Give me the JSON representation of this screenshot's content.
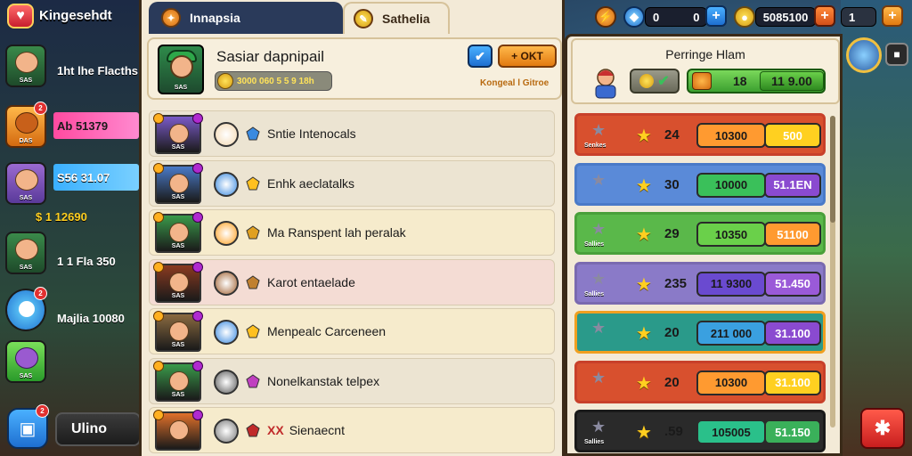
{
  "app": {
    "title": "Kingesehdt",
    "logo_icon": "shield-heart-icon"
  },
  "topbar": {
    "resources": [
      {
        "icon": "lightning-coin-icon",
        "value": ""
      },
      {
        "icon": "blue-gem-icon",
        "value": "0"
      },
      {
        "icon": "gem-value-icon",
        "value": "0"
      },
      {
        "icon": "gold-coin-icon",
        "value": "5085100"
      },
      {
        "icon": "extra-icon",
        "value": "1"
      }
    ],
    "plus_label": "+"
  },
  "tabs": [
    {
      "label": "Innapsia",
      "icon": "orange-token-icon",
      "active": true
    },
    {
      "label": "Sathelia",
      "icon": "gold-token-icon",
      "active": false
    }
  ],
  "sidebar": {
    "items": [
      {
        "tag": "SAS",
        "stat": "1ht lhe Flacths",
        "stat_color": "#ffffff",
        "badge": ""
      },
      {
        "tag": "DAS",
        "stat": "Ab 51379",
        "stat_color": "#ff62b0",
        "badge": "2"
      },
      {
        "tag": "SAS",
        "stat": "S56 31.07",
        "stat_color": "#5ac8ff",
        "badge": ""
      },
      {
        "tag": "",
        "stat": "$ 1 12690",
        "stat_color": "#ffffff",
        "badge": ""
      },
      {
        "tag": "SAS",
        "stat": "1 1 Fla 350",
        "stat_color": "#ffffff",
        "badge": ""
      },
      {
        "tag": "",
        "stat": "Majlia 10080",
        "stat_color": "#ffffff",
        "badge": "2"
      },
      {
        "tag": "SAS",
        "stat": "",
        "stat_color": "#ffffff",
        "badge": ""
      }
    ],
    "bottom_badge": "2",
    "bottom_label": "Ulino"
  },
  "profile": {
    "name": "Sasiar dapnipail",
    "avatar_label": "SAS",
    "currency": "3000 060 5 5 9 18h",
    "check_label": "✔",
    "button_label": "+ OKT",
    "sub_text": "Kongeal l Gitroe"
  },
  "quests": [
    {
      "title": "Sntie Intenocals",
      "bg": "#ece4d2",
      "thumb": "#7a5ac8",
      "circ": "#f4d8b0",
      "gem": "#3a8ae0",
      "cap": "SAS"
    },
    {
      "title": "Enhk aeclatalks",
      "bg": "#ece4d2",
      "thumb": "#4a7ac8",
      "circ": "#3a8ae0",
      "gem": "#ffc020",
      "cap": "SAS"
    },
    {
      "title": "Ma Ranspent lah peralak",
      "bg": "#f6ebcc",
      "thumb": "#3a9a4a",
      "circ": "#ffa020",
      "gem": "#e0a020",
      "cap": "SAS"
    },
    {
      "title": "Karot entaelade",
      "bg": "#f4dcd4",
      "thumb": "#8a3a20",
      "circ": "#a06030",
      "gem": "#c08030",
      "cap": "SAS"
    },
    {
      "title": "Menpealc Carceneen",
      "bg": "#f6ebcc",
      "thumb": "#8a6a40",
      "circ": "#3a8ae0",
      "gem": "#ffc020",
      "cap": "SAS"
    },
    {
      "title": "Nonelkanstak telpex",
      "bg": "#ece4d2",
      "thumb": "#3a9a4a",
      "circ": "#5a5a5a",
      "gem": "#c040c0",
      "cap": "SAS"
    },
    {
      "title": "Sienaecnt",
      "bg": "#f6ebcc",
      "thumb": "#e0702a",
      "circ": "#7a7a7a",
      "gem": "#c02a2a",
      "cap": "",
      "prefix": "XX"
    }
  ],
  "leaderboard": {
    "title": "Perringe Hlam",
    "header_value_1": "18",
    "header_value_2": "11 9.00",
    "rows": [
      {
        "label": "Senkes",
        "rank": "24",
        "a": "10300",
        "b": "500",
        "border": "#c8402a",
        "bg": "#d8502e",
        "pa": "#ff9a30",
        "pb": "#ffd020"
      },
      {
        "label": "",
        "rank": "30",
        "a": "10000",
        "b": "51.1EN",
        "border": "#4a7ac8",
        "bg": "#5a8ad8",
        "pa": "#3ac05a",
        "pb": "#8a4ad0"
      },
      {
        "label": "Sallies",
        "rank": "29",
        "a": "10350",
        "b": "51100",
        "border": "#4aa03a",
        "bg": "#5ab84a",
        "pa": "#6ad04a",
        "pb": "#ff9a30"
      },
      {
        "label": "Sallies",
        "rank": "235",
        "a": "11 9300",
        "b": "51.450",
        "border": "#7a6ab0",
        "bg": "#8a7ac8",
        "pa": "#6a4ad0",
        "pb": "#9a5ad8"
      },
      {
        "label": "",
        "rank": "20",
        "a": "211 000",
        "b": "31.100",
        "border": "#f0a020",
        "bg": "#2a9a8a",
        "pa": "#3aa0e0",
        "pb": "#8a4ad0"
      },
      {
        "label": "",
        "rank": "20",
        "a": "10300",
        "b": "31.100",
        "border": "#c8402a",
        "bg": "#d8502e",
        "pa": "#ff9a30",
        "pb": "#ffd020"
      },
      {
        "label": "Sallies",
        "rank": ".59",
        "a": "105005",
        "b": "51.150",
        "border": "#1a1a1a",
        "bg": "#2a2a2a",
        "pa": "#2ac08a",
        "pb": "#3ab05a"
      }
    ]
  }
}
